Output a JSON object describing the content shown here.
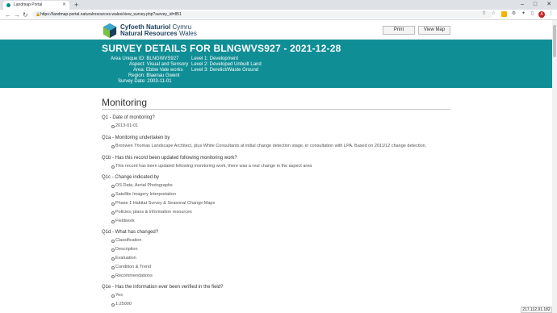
{
  "browser": {
    "tab_title": "Landmap Portal",
    "new_tab_symbol": "+",
    "url": "https://landmap-portal.naturalresources.wales/view_survey.php?survey_id=851",
    "status_ip": "217.112.91.182",
    "profile_initial": "A"
  },
  "site": {
    "logo_line1": "Cyfoeth Naturiol",
    "logo_line1_light": "Cymru",
    "logo_line2": "Natural Resources",
    "logo_line2_light": "Wales",
    "print_label": "Print",
    "view_map_label": "View Map"
  },
  "survey": {
    "title": "SURVEY DETAILS FOR BLNGWVS927 - 2021-12-28",
    "fields": [
      {
        "label": "Area Unique ID:",
        "value": "BLNGWVS927"
      },
      {
        "label": "Aspect:",
        "value": "Visual and Sensory"
      },
      {
        "label": "Area:",
        "value": "Ebbw Vale works"
      },
      {
        "label": "Region:",
        "value": "Blaenau Gwent"
      },
      {
        "label": "Survey Date:",
        "value": "2003-11-01"
      }
    ],
    "levels": [
      "Level 1: Development",
      "Level 2: Developed Unbuilt Land",
      "Level 3: Derelict/Waste Ground"
    ]
  },
  "monitoring": {
    "heading": "Monitoring",
    "questions": [
      {
        "q": "Q1 - Date of monitoring?",
        "answers": [
          "2013-01-01"
        ]
      },
      {
        "q": "Q1a - Monitoring undertaken by",
        "answers": [
          "Bronwen Thomas Landscape Architect, plus White Consultants at initial change detection stage, in consultation with LPA. Based on 2011/12 change detection."
        ]
      },
      {
        "q": "Q1b - Has this record been updated following monitoring work?",
        "answers": [
          "This record has been updated following monitoring work, there was a real change in the aspect area"
        ]
      },
      {
        "q": "Q1c - Change indicated by",
        "answers": [
          "OS Data, Aerial Photographs",
          "Satellite Imagery Interpretation",
          "Phase 1 Habitat Survey & Seasonal Change Maps",
          "Policies, plans & information resources",
          "Fieldwork"
        ]
      },
      {
        "q": "Q1d - What has changed?",
        "answers": [
          "Classification",
          "Description",
          "Evaluation",
          "Condition & Trend",
          "Recommendations"
        ]
      },
      {
        "q": "Q1e - Has the information ever been verified in the field?",
        "answers": [
          "Yes",
          "1:25000"
        ]
      }
    ]
  }
}
